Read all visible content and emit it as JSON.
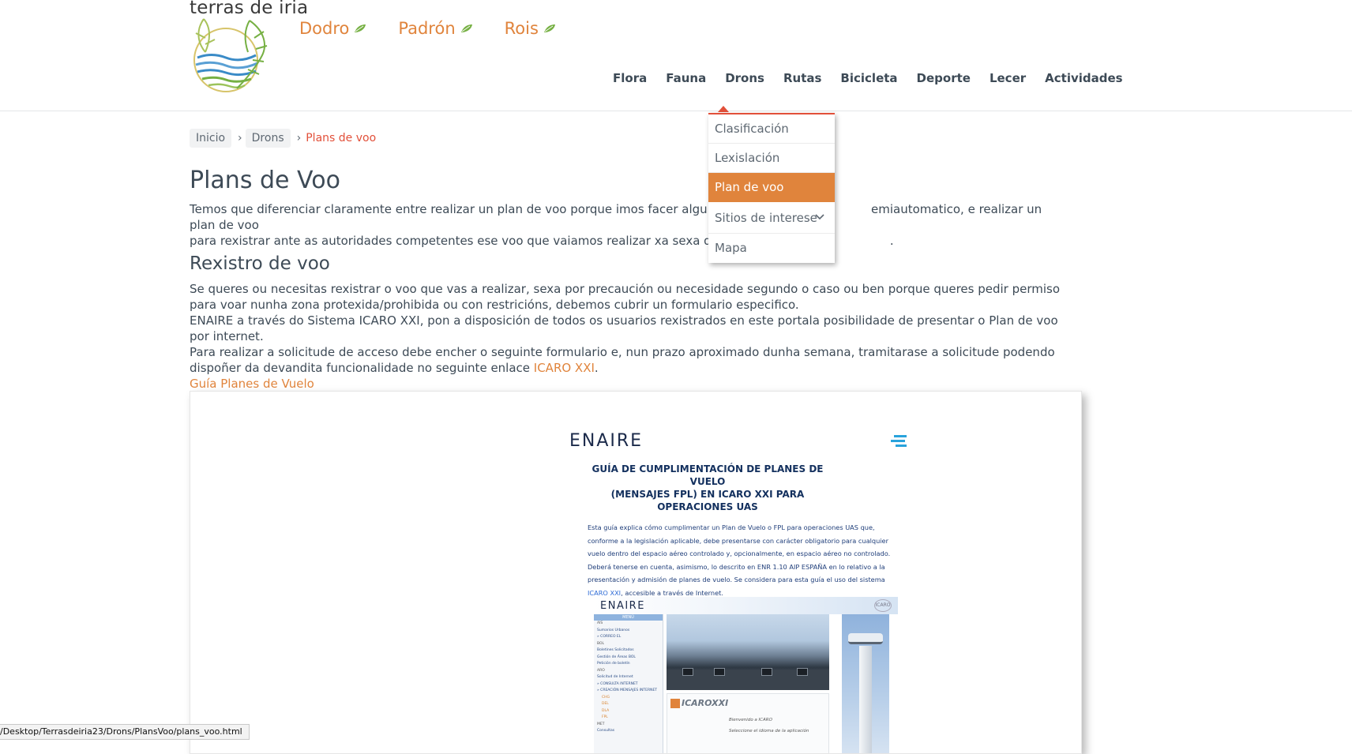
{
  "header": {
    "logo_text": "terras de iria",
    "towns": [
      {
        "label": "Dodro"
      },
      {
        "label": "Padrón"
      },
      {
        "label": "Rois"
      }
    ],
    "nav": [
      "Flora",
      "Fauna",
      "Drons",
      "Rutas",
      "Bicicleta",
      "Deporte",
      "Lecer",
      "Actividades"
    ]
  },
  "dropdown": {
    "items": [
      "Clasificación",
      "Lexislación",
      "Plan de voo",
      "Sitios de interese",
      "Mapa"
    ],
    "active": "Plan de voo"
  },
  "breadcrumb": {
    "items": [
      "Inicio",
      "Drons"
    ],
    "current": "Plans de voo"
  },
  "content": {
    "title": "Plans de Voo",
    "intro_a": "Temos que diferenciar claramente entre realizar un plan de voo porque imos facer algun tipo d",
    "intro_b": "emiautomatico, e realizar un plan de voo",
    "intro_c": "para rexistrar ante as autoridades competentes ese voo que vaiamos realizar xa sexa de forma",
    "intro_d": ".",
    "subtitle": "Rexistro de voo",
    "para1": "Se queres ou necesitas rexistrar o voo que vas a realizar, sexa por precaución ou necesidade segundo o caso ou ben porque queres pedir permiso para voar nunha zona protexida/prohibida ou con restricións, debemos cubrir un formulario especifico.",
    "para2": "ENAIRE a través do Sistema ICARO XXI, pon a disposición de todos os usuarios rexistrados en este portala posibilidade de presentar o Plan de voo por internet.",
    "para3_pre": "Para realizar a solicitude de acceso debe encher o seguinte formulario e, nun prazo aproximado dunha semana, tramitarase a solicitude podendo dispoñer da devandita funcionalidade no seguinte enlace ",
    "para3_link": "ICARO XXI",
    "para3_post": ".",
    "guide_link": "Guía Planes de Vuelo"
  },
  "document": {
    "logo": "ENAIRE",
    "title_line1": "GUÍA DE CUMPLIMENTACIÓN DE PLANES DE VUELO",
    "title_line2": "(MENSAJES FPL) EN ICARO XXI PARA OPERACIONES UAS",
    "body_1": "Esta guía explica cómo cumplimentar un Plan de Vuelo o FPL para operaciones UAS que, conforme a la legislación aplicable, debe presentarse con carácter obligatorio para cualquier vuelo dentro del espacio aéreo controlado y, opcionalmente, en espacio aéreo no controlado. Deberá tenerse en cuenta, asimismo, lo descrito en ENR 1.10 AIP ESPAÑA en lo relativo a la presentación y admisión de planes de vuelo. Se considera para esta guía el uso del sistema ",
    "body_link": "ICARO XXI",
    "body_2": ", accesible a través de Internet.",
    "shot": {
      "logo": "ENAIRE",
      "logo2": "ICARO",
      "menu_title": "MENÚ",
      "menu_items": [
        {
          "t": "AIS",
          "k": "h"
        },
        {
          "t": "Sumarios Urbanos",
          "k": ""
        },
        {
          "t": "» CORREO EL",
          "k": ""
        },
        {
          "t": "BOL",
          "k": "h"
        },
        {
          "t": "Boletines Solicitados",
          "k": ""
        },
        {
          "t": "Gestión de Áreas BOL",
          "k": ""
        },
        {
          "t": "Petición de boletín",
          "k": ""
        },
        {
          "t": "ARO",
          "k": "h"
        },
        {
          "t": "Solicitud de Internet",
          "k": ""
        },
        {
          "t": "» CONSULTA INTERNET",
          "k": ""
        },
        {
          "t": "» CREACIÓN MENSAJES INTERNET",
          "k": ""
        },
        {
          "t": "CHG",
          "k": "o"
        },
        {
          "t": "DEL",
          "k": "o"
        },
        {
          "t": "DLA",
          "k": "o"
        },
        {
          "t": "FPL",
          "k": "o"
        },
        {
          "t": "MET",
          "k": "h"
        },
        {
          "t": "Consultas",
          "k": ""
        }
      ],
      "icaro_label": "ICAROXXI",
      "welcome_1": "Bienvenido a ICARO",
      "welcome_2": "Seleccione el idioma de la aplicación"
    }
  },
  "statusbar": "/Desktop/Terrasdeiria23/Drons/PlansVoo/plans_voo.html"
}
